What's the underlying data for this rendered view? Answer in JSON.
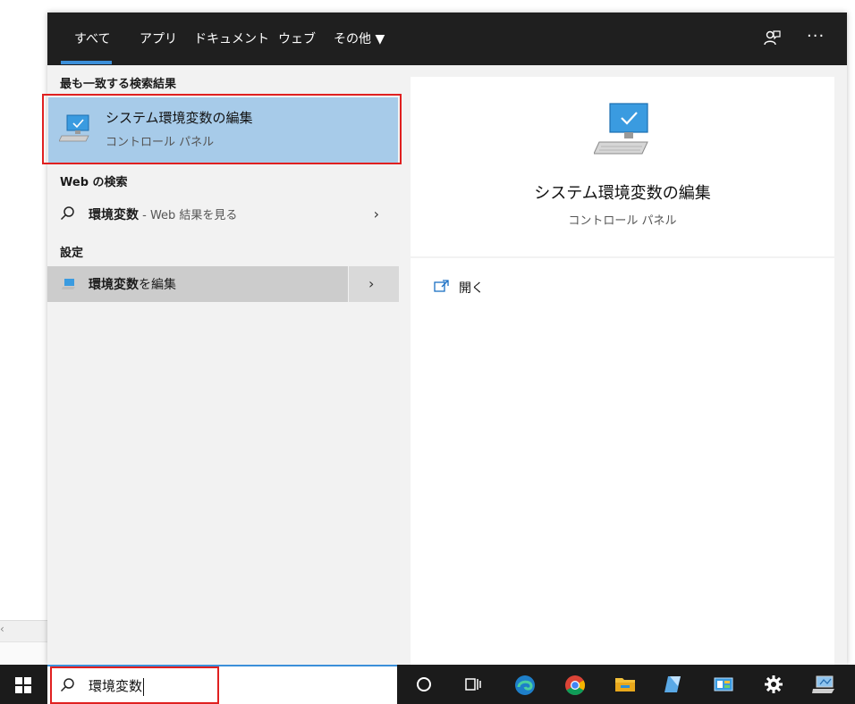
{
  "tabs": [
    {
      "label": "すべて",
      "active": true
    },
    {
      "label": "アプリ"
    },
    {
      "label": "ドキュメント"
    },
    {
      "label": "ウェブ"
    },
    {
      "label": "その他 ▼"
    }
  ],
  "top_icons": {
    "feedback": "feedback-icon",
    "more": "···"
  },
  "sections": {
    "best_match": "最も一致する検索結果",
    "web": "Web の検索",
    "settings": "設定"
  },
  "best_match": {
    "title": "システム環境変数の編集",
    "subtitle": "コントロール パネル"
  },
  "web_result": {
    "query": "環境変数",
    "suffix": " - Web 結果を見る",
    "chevron": "›"
  },
  "settings_result": {
    "query": "環境変数",
    "rest": "を編集",
    "chevron": "›"
  },
  "detail": {
    "title": "システム環境変数の編集",
    "subtitle": "コントロール パネル",
    "action": "開く"
  },
  "taskbar": {
    "search_value": "環境変数",
    "icons": [
      "cortana-icon",
      "task-view-icon",
      "edge-icon",
      "chrome-icon",
      "file-explorer-icon",
      "notepad-icon",
      "control-panel-icon",
      "settings-gear-icon",
      "system-icon"
    ]
  },
  "colors": {
    "accent": "#3b8fd9",
    "selection": "#a7cbe9",
    "highlight_outline": "#e02020",
    "topbar": "#1f1f1f"
  }
}
